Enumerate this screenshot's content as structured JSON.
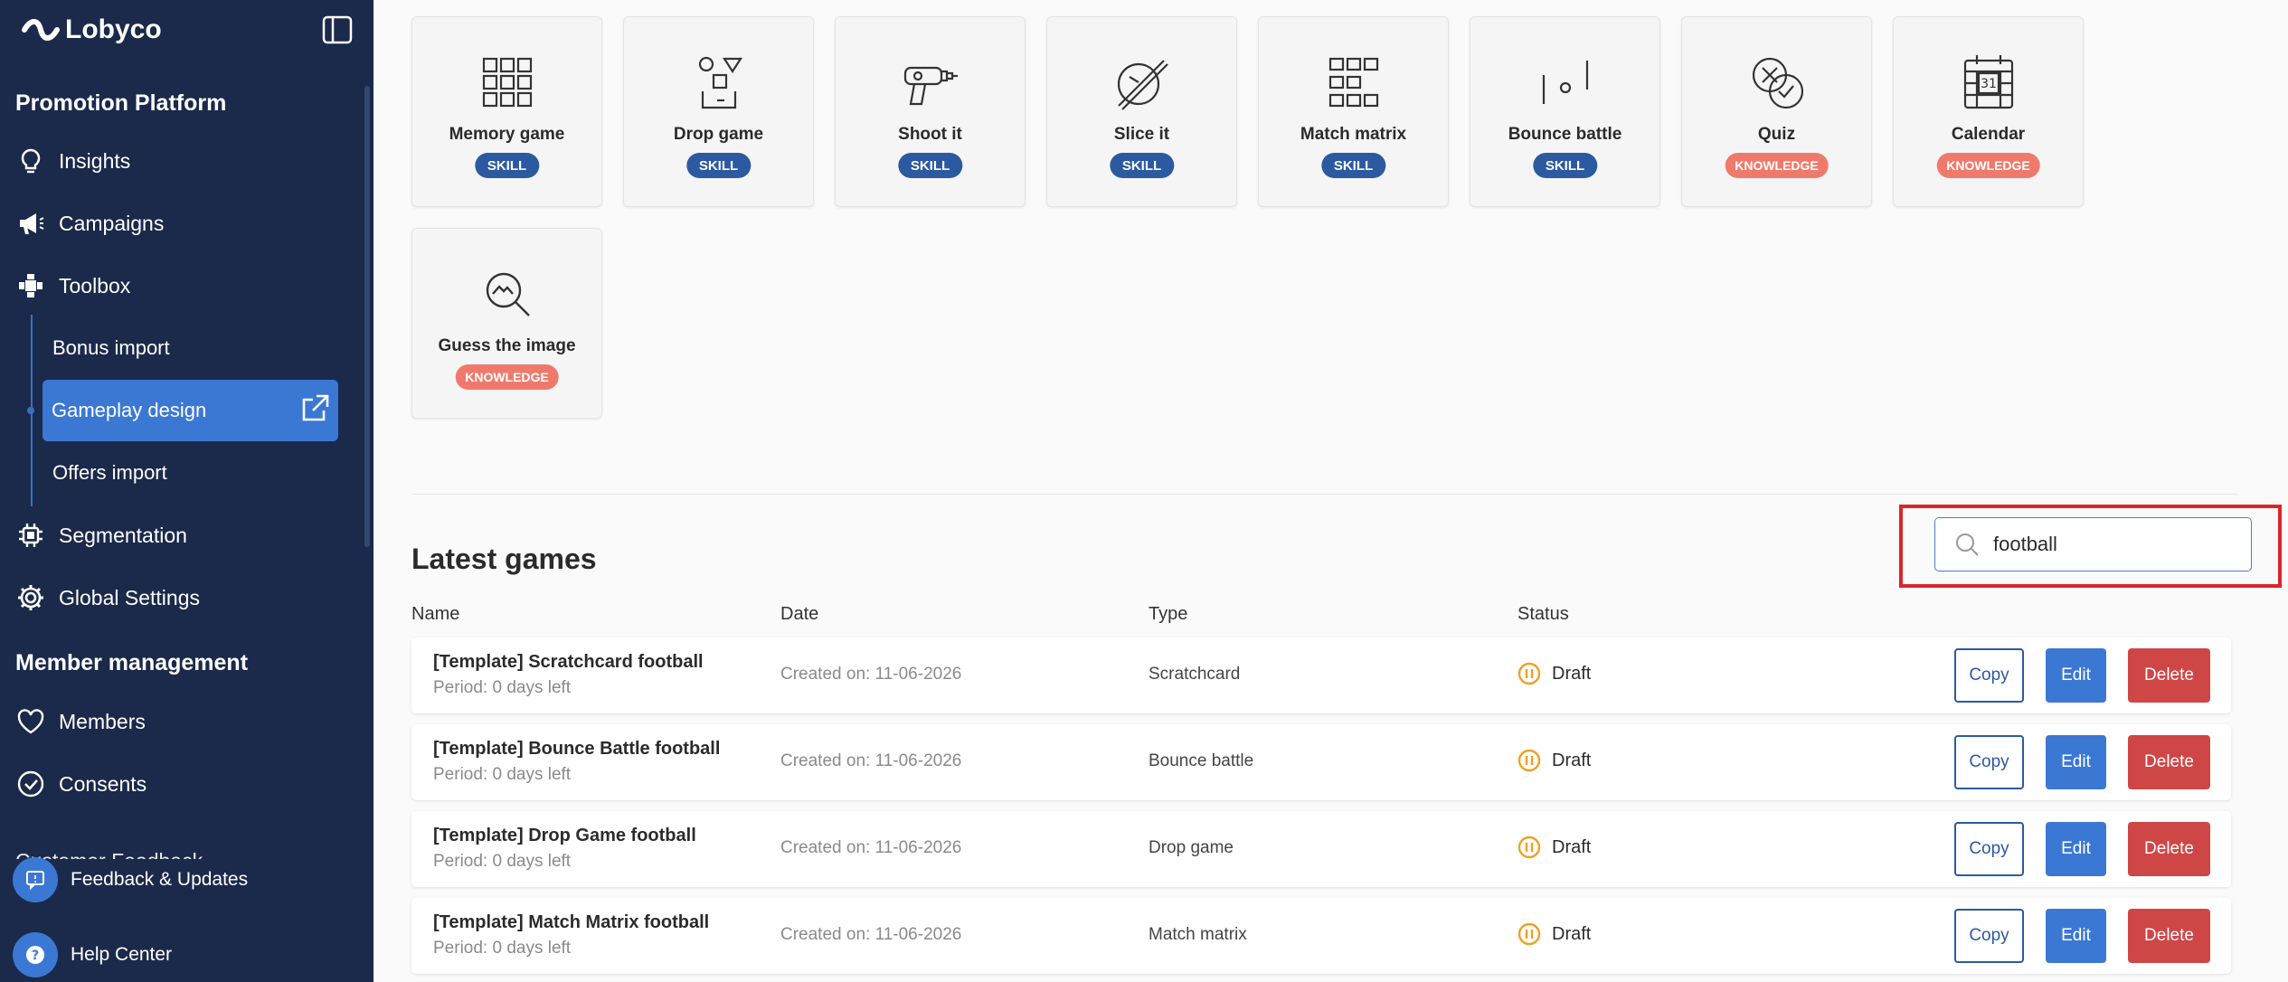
{
  "sidebar": {
    "logo_text": "Lobyco",
    "promotion_section": "Promotion Platform",
    "nav": {
      "insights": "Insights",
      "campaigns": "Campaigns",
      "toolbox": "Toolbox",
      "segmentation": "Segmentation",
      "global_settings": "Global Settings",
      "members": "Members",
      "consents": "Consents",
      "customer_feedback": "Customer Feedback"
    },
    "toolbox_sub": {
      "bonus_import": "Bonus import",
      "gameplay_design": "Gameplay design",
      "offers_import": "Offers import"
    },
    "member_section": "Member management",
    "feedback_updates": "Feedback & Updates",
    "help_center": "Help Center"
  },
  "games": [
    {
      "name": "Memory game",
      "badge": "SKILL",
      "icon": "memory-grid-icon"
    },
    {
      "name": "Drop game",
      "badge": "SKILL",
      "icon": "drop-shapes-icon"
    },
    {
      "name": "Shoot it",
      "badge": "SKILL",
      "icon": "blaster-icon"
    },
    {
      "name": "Slice it",
      "badge": "SKILL",
      "icon": "slice-fruit-icon"
    },
    {
      "name": "Match matrix",
      "badge": "SKILL",
      "icon": "matrix-grid-icon"
    },
    {
      "name": "Bounce battle",
      "badge": "SKILL",
      "icon": "bounce-paddles-icon"
    },
    {
      "name": "Quiz",
      "badge": "KNOWLEDGE",
      "icon": "quiz-check-icon"
    },
    {
      "name": "Calendar",
      "badge": "KNOWLEDGE",
      "icon": "calendar-icon",
      "calendar_day": "31"
    },
    {
      "name": "Guess the image",
      "badge": "KNOWLEDGE",
      "icon": "image-magnifier-icon"
    }
  ],
  "latest": {
    "title": "Latest games",
    "search_value": "football",
    "columns": {
      "name": "Name",
      "date": "Date",
      "type": "Type",
      "status": "Status"
    },
    "buttons": {
      "copy": "Copy",
      "edit": "Edit",
      "delete": "Delete"
    },
    "rows": [
      {
        "name": "[Template] Scratchcard football",
        "period": "Period: 0 days left",
        "date": "Created on: 11-06-2026",
        "type": "Scratchcard",
        "status": "Draft"
      },
      {
        "name": "[Template] Bounce Battle football",
        "period": "Period: 0 days left",
        "date": "Created on: 11-06-2026",
        "type": "Bounce battle",
        "status": "Draft"
      },
      {
        "name": "[Template] Drop Game football",
        "period": "Period: 0 days left",
        "date": "Created on: 11-06-2026",
        "type": "Drop game",
        "status": "Draft"
      },
      {
        "name": "[Template] Match Matrix football",
        "period": "Period: 0 days left",
        "date": "Created on: 11-06-2026",
        "type": "Match matrix",
        "status": "Draft"
      }
    ]
  },
  "colors": {
    "sidebar_bg": "#1b2a4a",
    "accent_blue": "#3b78d4",
    "skill_badge": "#2c5aa0",
    "knowledge_badge": "#ef7a6b",
    "delete_red": "#cf4646",
    "draft_orange": "#f0a020",
    "highlight_red": "#d9262b"
  }
}
